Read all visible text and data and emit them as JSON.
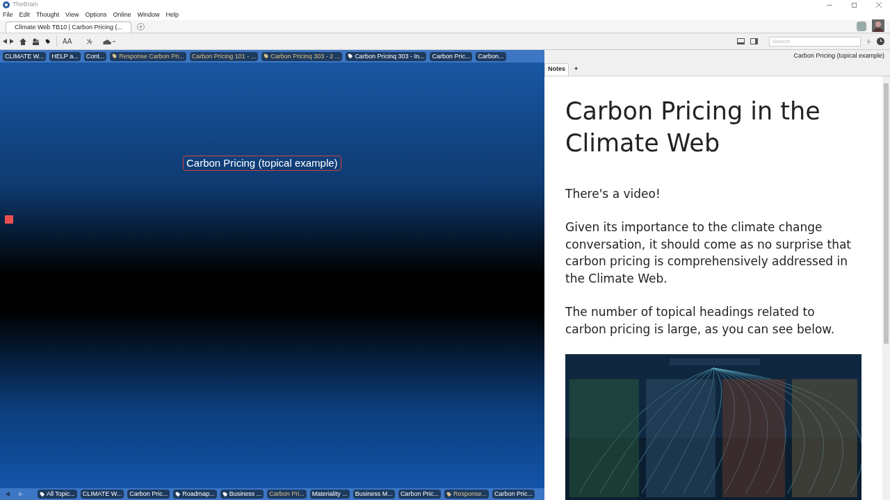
{
  "window": {
    "title": "TheBrain"
  },
  "menu": [
    "File",
    "Edit",
    "Thought",
    "View",
    "Options",
    "Online",
    "Window",
    "Help"
  ],
  "tabs": [
    {
      "label": "Climate Web TB10 | Carbon Pricing (...",
      "selected": true
    }
  ],
  "toolbar": {
    "font_button": "AA",
    "search": {
      "placeholder": "Search"
    }
  },
  "top_pins": [
    {
      "label": "CLIMATE W...",
      "tagged": false,
      "highlighted": false
    },
    {
      "label": "HELP a...",
      "tagged": false,
      "highlighted": false
    },
    {
      "label": "Cont...",
      "tagged": false,
      "highlighted": false
    },
    {
      "label": "Response Carbon Pri...",
      "tagged": true,
      "highlighted": true
    },
    {
      "label": "Carbon  Pricing 101 - ...",
      "tagged": false,
      "highlighted": true
    },
    {
      "label": "Carbon Pricinq 303 - 2 ...",
      "tagged": true,
      "highlighted": true
    },
    {
      "label": "Carbon Pricinq 303 - In...",
      "tagged": true,
      "highlighted": false
    },
    {
      "label": "Carbon Pric...",
      "tagged": false,
      "highlighted": false
    },
    {
      "label": "Carbon...",
      "tagged": false,
      "highlighted": false
    }
  ],
  "active_thought": "Carbon Pricing (topical example)",
  "bottom_pins": [
    {
      "label": "All Topic...",
      "tagged": true,
      "highlighted": false
    },
    {
      "label": "CLIMATE W...",
      "tagged": false,
      "highlighted": false
    },
    {
      "label": "Carbon Pric...",
      "tagged": false,
      "highlighted": false
    },
    {
      "label": "Roadmap...",
      "tagged": true,
      "highlighted": false
    },
    {
      "label": "Business ...",
      "tagged": true,
      "highlighted": false
    },
    {
      "label": "Carbon  Pri...",
      "tagged": false,
      "highlighted": true
    },
    {
      "label": "Materiality ...",
      "tagged": false,
      "highlighted": false
    },
    {
      "label": "Business M...",
      "tagged": false,
      "highlighted": false
    },
    {
      "label": "Carbon Pric...",
      "tagged": false,
      "highlighted": false
    },
    {
      "label": "Response...",
      "tagged": true,
      "highlighted": true
    },
    {
      "label": "Carbon Pric...",
      "tagged": false,
      "highlighted": false
    }
  ],
  "notes": {
    "path_title": "Carbon Pricing (topical example)",
    "tabs": [
      {
        "label": "Notes",
        "selected": true
      },
      {
        "label": "+",
        "selected": false
      }
    ],
    "heading": "Carbon Pricing in the Climate Web",
    "paragraphs": [
      "There's a video!",
      "Given its importance to the climate change conversation, it should come as no surprise that carbon pricing is comprehensively addressed in the Climate Web.",
      "The number of topical headings related to carbon pricing is large, as you can see below."
    ]
  }
}
